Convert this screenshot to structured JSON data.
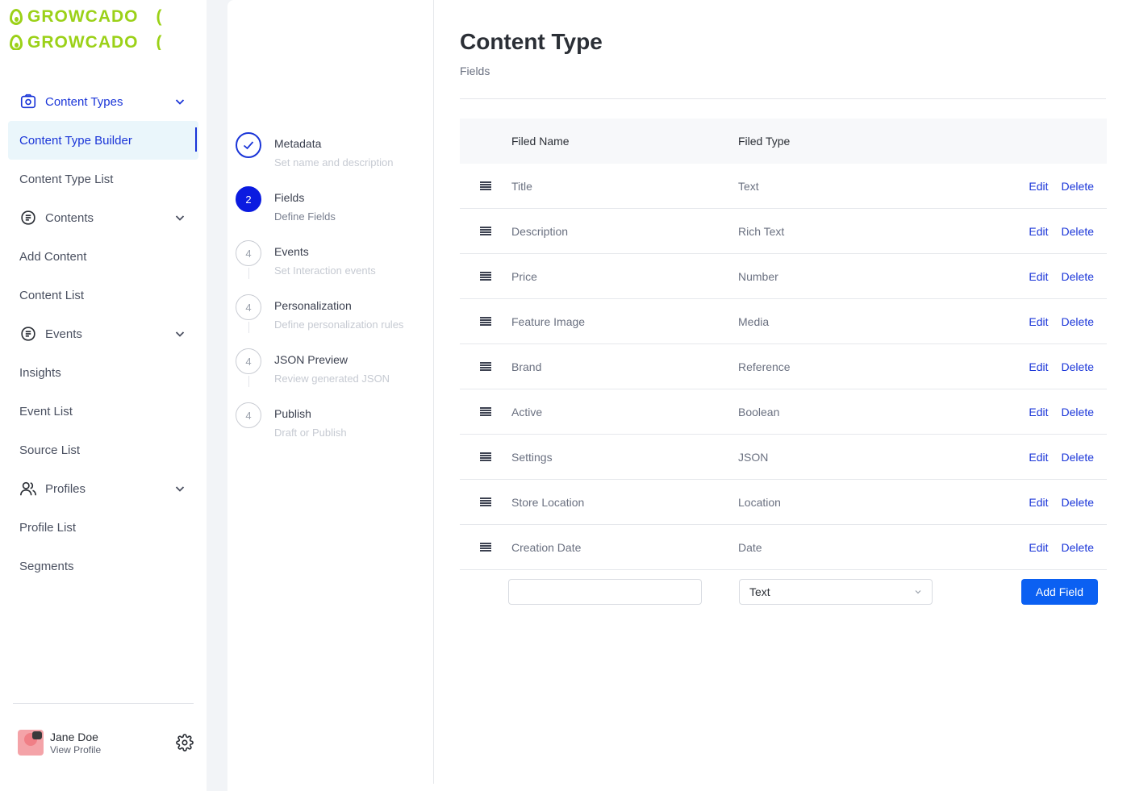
{
  "brand": {
    "name": "GROWCADO",
    "color": "#9bd118"
  },
  "sidebar": {
    "groups": [
      {
        "label": "Content Types",
        "icon": "camera-icon",
        "active": true,
        "items": [
          {
            "label": "Content Type Builder",
            "selected": true
          },
          {
            "label": "Content Type List"
          }
        ]
      },
      {
        "label": "Contents",
        "icon": "document-icon",
        "items": [
          {
            "label": "Add Content"
          },
          {
            "label": "Content List"
          }
        ]
      },
      {
        "label": "Events",
        "icon": "document-icon",
        "items": [
          {
            "label": "Insights"
          },
          {
            "label": "Event List"
          },
          {
            "label": "Source List"
          }
        ]
      },
      {
        "label": "Profiles",
        "icon": "users-icon",
        "items": [
          {
            "label": "Profile List"
          },
          {
            "label": "Segments"
          }
        ]
      }
    ],
    "user": {
      "name": "Jane Doe",
      "link": "View Profile"
    }
  },
  "stepper": {
    "steps": [
      {
        "number": "",
        "title": "Metadata",
        "subtitle": "Set name and description",
        "state": "done"
      },
      {
        "number": "2",
        "title": "Fields",
        "subtitle": "Define Fields",
        "state": "current"
      },
      {
        "number": "4",
        "title": "Events",
        "subtitle": "Set Interaction events",
        "state": "pending"
      },
      {
        "number": "4",
        "title": "Personalization",
        "subtitle": "Define personalization rules",
        "state": "pending"
      },
      {
        "number": "4",
        "title": "JSON Preview",
        "subtitle": "Review generated JSON",
        "state": "pending"
      },
      {
        "number": "4",
        "title": "Publish",
        "subtitle": "Draft or Publish",
        "state": "pending"
      }
    ]
  },
  "main": {
    "title": "Content Type",
    "subtitle": "Fields",
    "table": {
      "headers": {
        "name": "Filed Name",
        "type": "Filed Type"
      },
      "rows": [
        {
          "name": "Title",
          "type": "Text"
        },
        {
          "name": "Description",
          "type": "Rich Text"
        },
        {
          "name": "Price",
          "type": "Number"
        },
        {
          "name": "Feature Image",
          "type": "Media"
        },
        {
          "name": "Brand",
          "type": "Reference"
        },
        {
          "name": "Active",
          "type": "Boolean"
        },
        {
          "name": "Settings",
          "type": "JSON"
        },
        {
          "name": "Store Location",
          "type": "Location"
        },
        {
          "name": "Creation Date",
          "type": "Date"
        }
      ],
      "edit_label": "Edit",
      "delete_label": "Delete"
    },
    "add_row": {
      "name_value": "",
      "type_value": "Text",
      "button_label": "Add Field"
    }
  },
  "colors": {
    "accent": "#1a35d8",
    "button": "#0b60f2",
    "selected_bg": "#eaf6fb"
  }
}
